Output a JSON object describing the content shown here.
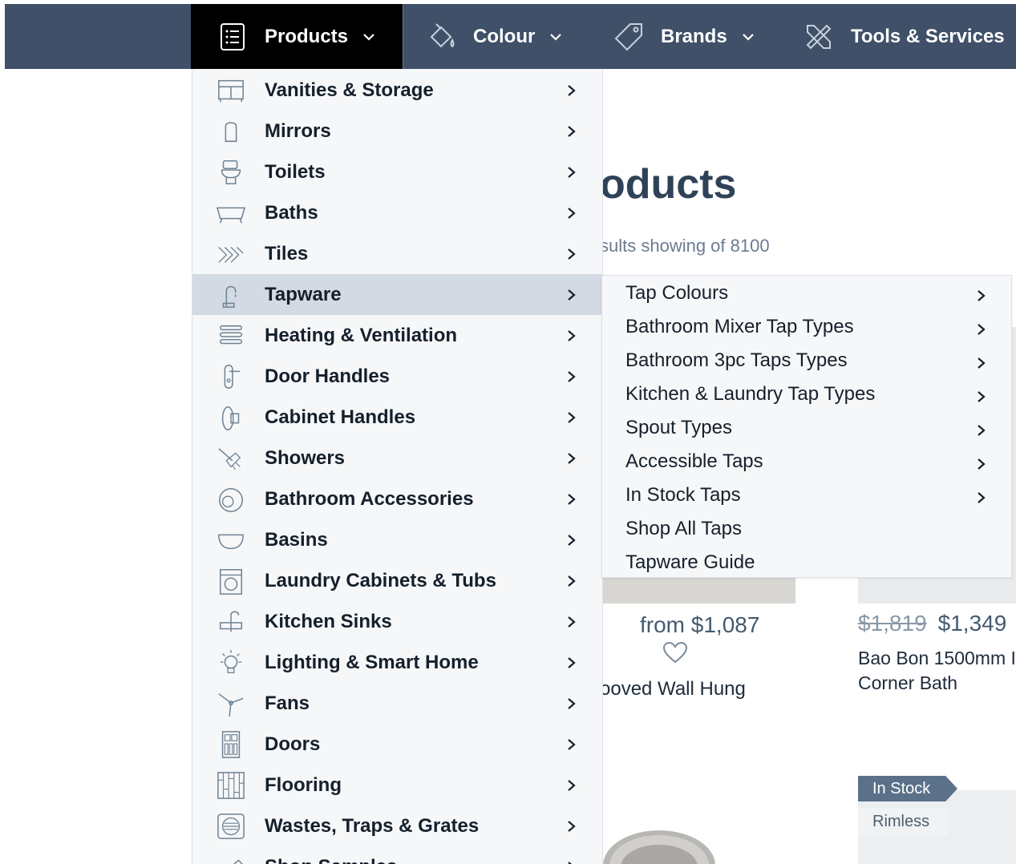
{
  "nav": {
    "products": "Products",
    "colour": "Colour",
    "brands": "Brands",
    "tools": "Tools & Services"
  },
  "page": {
    "title": "oducts",
    "subtitle": "sults showing of 8100"
  },
  "products": [
    {
      "price": "from $1,087",
      "name": "ooved Wall Hung"
    },
    {
      "old_price": "$1,819",
      "price": "$1,349",
      "name": "Bao Bon 1500mm I Corner Bath"
    }
  ],
  "badges": {
    "stock": "In Stock",
    "feature": "Rimless"
  },
  "menu": {
    "items": [
      {
        "label": "Vanities & Storage",
        "icon": "vanity-icon"
      },
      {
        "label": "Mirrors",
        "icon": "mirror-icon"
      },
      {
        "label": "Toilets",
        "icon": "toilet-icon"
      },
      {
        "label": "Baths",
        "icon": "bath-icon"
      },
      {
        "label": "Tiles",
        "icon": "tiles-icon"
      },
      {
        "label": "Tapware",
        "icon": "tap-icon",
        "active": true
      },
      {
        "label": "Heating & Ventilation",
        "icon": "heater-icon"
      },
      {
        "label": "Door Handles",
        "icon": "door-handle-icon"
      },
      {
        "label": "Cabinet Handles",
        "icon": "cabinet-handle-icon"
      },
      {
        "label": "Showers",
        "icon": "shower-icon"
      },
      {
        "label": "Bathroom Accessories",
        "icon": "accessories-icon"
      },
      {
        "label": "Basins",
        "icon": "basin-icon"
      },
      {
        "label": "Laundry Cabinets & Tubs",
        "icon": "laundry-icon"
      },
      {
        "label": "Kitchen Sinks",
        "icon": "kitchen-sink-icon"
      },
      {
        "label": "Lighting & Smart Home",
        "icon": "light-bulb-icon"
      },
      {
        "label": "Fans",
        "icon": "fan-icon"
      },
      {
        "label": "Doors",
        "icon": "door-icon"
      },
      {
        "label": "Flooring",
        "icon": "flooring-icon"
      },
      {
        "label": "Wastes, Traps & Grates",
        "icon": "waste-grate-icon"
      },
      {
        "label": "Shop Samples",
        "icon": "samples-icon"
      }
    ]
  },
  "submenu": {
    "items": [
      {
        "label": "Tap Colours",
        "has_children": true
      },
      {
        "label": "Bathroom Mixer Tap Types",
        "has_children": true
      },
      {
        "label": "Bathroom 3pc Taps Types",
        "has_children": true
      },
      {
        "label": "Kitchen & Laundry Tap Types",
        "has_children": true
      },
      {
        "label": "Spout Types",
        "has_children": true
      },
      {
        "label": "Accessible Taps",
        "has_children": true
      },
      {
        "label": "In Stock Taps",
        "has_children": true
      },
      {
        "label": "Shop All Taps",
        "has_children": false
      },
      {
        "label": "Tapware Guide",
        "has_children": false
      }
    ]
  },
  "colors": {
    "nav_bg": "#3f5068",
    "active_nav": "#000000",
    "menu_bg": "#f6f7f8",
    "active_item": "#d3dae3"
  }
}
